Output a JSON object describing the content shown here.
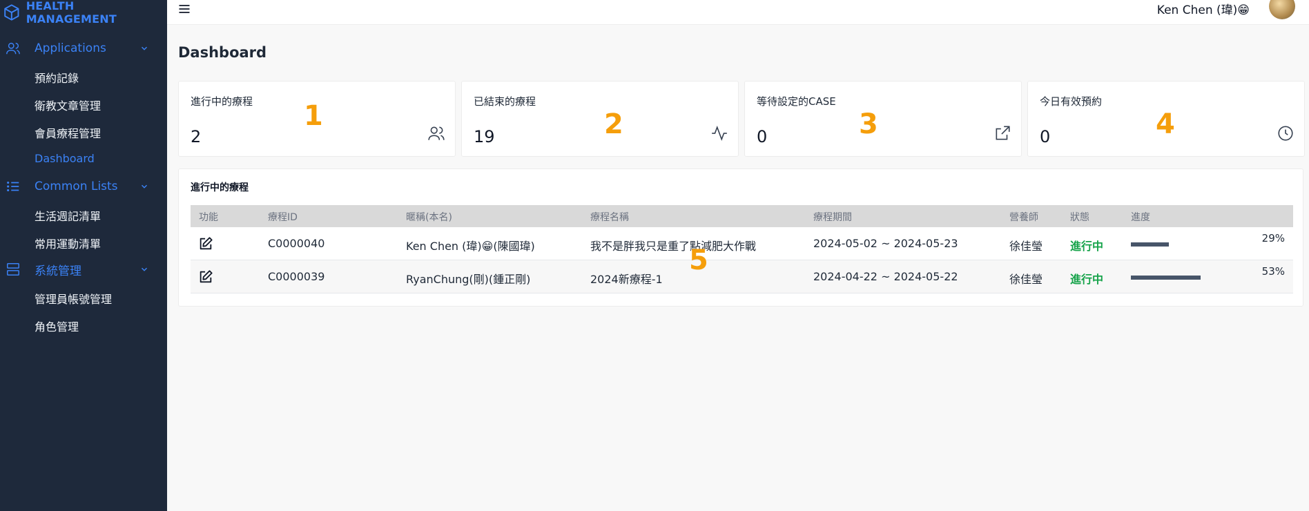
{
  "brand": {
    "name": "HEALTH MANAGEMENT"
  },
  "sidebar": {
    "sections": [
      {
        "label": "Applications",
        "items": [
          "預約記錄",
          "衛教文章管理",
          "會員療程管理",
          "Dashboard"
        ]
      },
      {
        "label": "Common Lists",
        "items": [
          "生活週記清單",
          "常用運動清單"
        ]
      },
      {
        "label": "系統管理",
        "items": [
          "管理員帳號管理",
          "角色管理"
        ]
      }
    ],
    "active_item": "Dashboard"
  },
  "topbar": {
    "user_name": "Ken Chen (瑋)😁"
  },
  "page": {
    "title": "Dashboard"
  },
  "cards": [
    {
      "label": "進行中的療程",
      "value": "2",
      "icon": "users-icon",
      "marker": "1"
    },
    {
      "label": "已結束的療程",
      "value": "19",
      "icon": "activity-icon",
      "marker": "2"
    },
    {
      "label": "等待設定的CASE",
      "value": "0",
      "icon": "external-link-icon",
      "marker": "3"
    },
    {
      "label": "今日有效預約",
      "value": "0",
      "icon": "clock-icon",
      "marker": "4"
    }
  ],
  "table": {
    "title": "進行中的療程",
    "headers": [
      "功能",
      "療程ID",
      "暱稱(本名)",
      "療程名稱",
      "療程期間",
      "營養師",
      "狀態",
      "進度"
    ],
    "rows": [
      {
        "id": "C0000040",
        "nickname": "Ken Chen (瑋)😁(陳國瑋)",
        "program": "我不是胖我只是重了點減肥大作戰",
        "period": "2024-05-02 ~ 2024-05-23",
        "dietitian": "徐佳瑩",
        "status": "進行中",
        "progress_percent": 29,
        "progress_label": "29%"
      },
      {
        "id": "C0000039",
        "nickname": "RyanChung(剛)(鍾正剛)",
        "program": "2024新療程-1",
        "period": "2024-04-22 ~ 2024-05-22",
        "dietitian": "徐佳瑩",
        "status": "進行中",
        "progress_percent": 53,
        "progress_label": "53%"
      }
    ],
    "marker": "5"
  },
  "colors": {
    "sidebar_bg": "#1e293b",
    "accent": "#3b82f6",
    "status_active": "#16a34a",
    "marker": "#f59e0b"
  }
}
